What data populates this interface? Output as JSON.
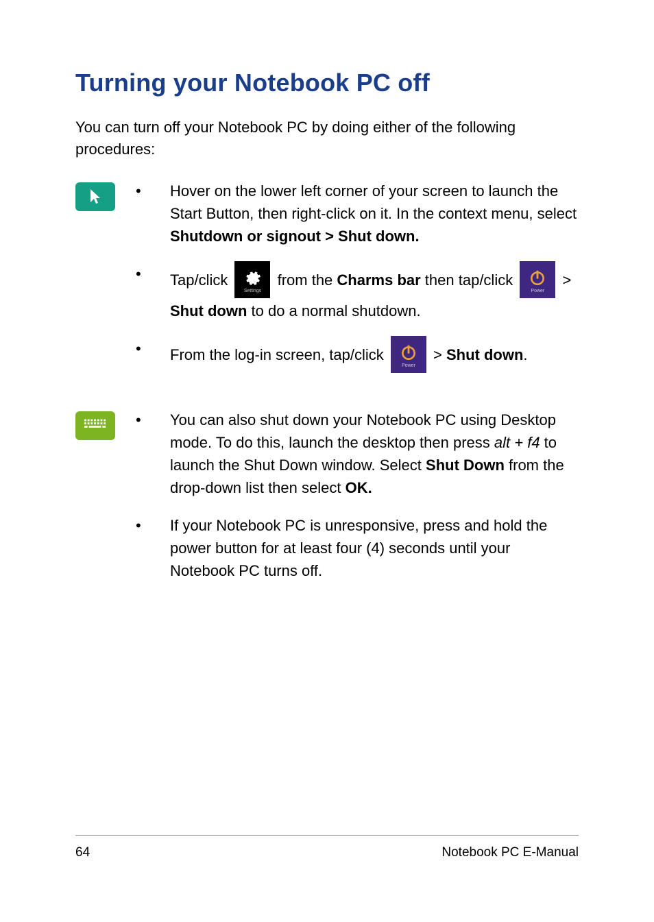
{
  "heading": "Turning your Notebook PC off",
  "intro": "You can turn off your Notebook PC by doing either of the following procedures:",
  "mouse": {
    "bullet1": {
      "t1": "Hover on the lower left corner of your screen to launch the Start Button, then right-click on it. In the context menu, select ",
      "b1": "Shutdown or signout > Shut down."
    },
    "bullet2": {
      "t1": "Tap/click ",
      "t2": " from  the ",
      "b1": "Charms bar",
      "t3": " then tap/click ",
      "t4": " > ",
      "b2": "Shut down",
      "t5": " to do a normal shutdown."
    },
    "bullet3": {
      "t1": "From the log-in screen, tap/click ",
      "t2": " > ",
      "b1": "Shut down",
      "t3": "."
    }
  },
  "keyboard": {
    "bullet1": {
      "t1": "You can also shut down your Notebook PC using Desktop mode. To do this, launch the desktop then press ",
      "i1": "alt + f4",
      "t2": " to launch the Shut Down window. Select ",
      "b1": "Shut Down",
      "t3": " from the drop-down list then select ",
      "b2": "OK."
    },
    "bullet2": {
      "t1": "If your Notebook PC is unresponsive, press and hold the power button for at least four (4) seconds until your Notebook PC turns off."
    }
  },
  "icons": {
    "settings_label": "Settings",
    "power_label": "Power"
  },
  "footer": {
    "page": "64",
    "title": "Notebook PC E-Manual"
  }
}
